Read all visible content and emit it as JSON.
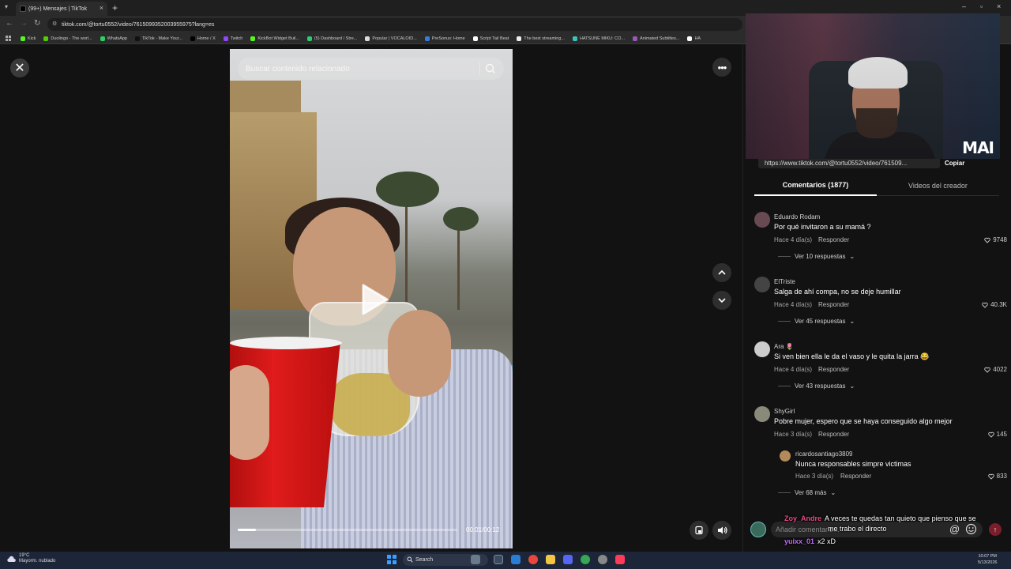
{
  "browser": {
    "tab_title": "(99+) Mensajes | TikTok",
    "new_tab": "+",
    "url": "tiktok.com/@tortu0552/video/7615099352003955975?lang=es",
    "bookmarks": [
      {
        "label": "Kick",
        "color": "#53fc18"
      },
      {
        "label": "Duolingo - The worl...",
        "color": "#58cc02"
      },
      {
        "label": "WhatsApp",
        "color": "#25d366"
      },
      {
        "label": "TikTok - Make Your...",
        "color": "#111111"
      },
      {
        "label": "Home / X",
        "color": "#000000"
      },
      {
        "label": "Twitch",
        "color": "#9146ff"
      },
      {
        "label": "KickBot Widget Buil...",
        "color": "#53fc18"
      },
      {
        "label": "(5) Dashboard / Stre...",
        "color": "#2ecc71"
      },
      {
        "label": "Popular | VOCALOID...",
        "color": "#dddddd"
      },
      {
        "label": "PreSonus: Home",
        "color": "#3a7bd5"
      },
      {
        "label": "Script Tail Beat",
        "color": "#ffffff"
      },
      {
        "label": "The best streaming...",
        "color": "#eeeeee"
      },
      {
        "label": "HATSUNE MIKU: CO...",
        "color": "#39c5bb"
      },
      {
        "label": "Animated Subtitles...",
        "color": "#9b59b6"
      },
      {
        "label": "HA",
        "color": "#ffffff"
      }
    ]
  },
  "player": {
    "search_placeholder": "Buscar contenido relacionado",
    "time": "00:01/00:12",
    "progress": 0.083
  },
  "panel": {
    "link": "https://www.tiktok.com/@tortu0552/video/761509...",
    "copy_label": "Copiar",
    "tab_comments": "Comentarios (1877)",
    "tab_creator": "Videos del creador",
    "reply_label": "Responder"
  },
  "webcam": {
    "logo": "MAI"
  },
  "comments": [
    {
      "user": "Eduardo Rodam",
      "text": "Por qué invitaron a su mamá ?",
      "date": "Hace 4 día(s)",
      "likes": "9748",
      "more": "Ver 10 respuestas",
      "avatar": "#6a4a52"
    },
    {
      "user": "ElTriste",
      "text": "Salga de ahí compa, no se deje humillar",
      "date": "Hace 4 día(s)",
      "likes": "40.3K",
      "more": "Ver 45 respuestas",
      "avatar": "#444444"
    },
    {
      "user": "Ara 🌷",
      "text": "Si ven bien ella le da el vaso y le quita la jarra 😂",
      "date": "Hace 4 día(s)",
      "likes": "4022",
      "more": "Ver 43 respuestas",
      "avatar": "#cccccc"
    },
    {
      "user": "ShyGirl",
      "text": "Pobre mujer, espero que se haya conseguido algo mejor",
      "date": "Hace 3 día(s)",
      "likes": "145",
      "avatar": "#8a8a7a"
    }
  ],
  "reply": {
    "user": "ricardosantiago3809",
    "text": "Nunca responsables simpre victimas",
    "date": "Hace 3 día(s)",
    "likes": "833",
    "more": "Ver 68 más",
    "avatar": "#b58a5a"
  },
  "comment_input": {
    "placeholder": "Añadir comentario..."
  },
  "stream_chat": [
    {
      "user": "Zoy_Andre",
      "text": "A veces te quedas tan quieto que pienso que se",
      "user_color": "#e84a8a"
    },
    {
      "user": "",
      "text": "me trabo el directo",
      "user_color": "#ffffff"
    },
    {
      "user": "yuixx_01",
      "text": "x2 xD",
      "user_color": "#c06bff"
    }
  ],
  "taskbar": {
    "temp": "19°C",
    "weather": "Mayorm. nublado",
    "search": "Search",
    "time": "10:07 PM",
    "date": "5/13/2026"
  }
}
